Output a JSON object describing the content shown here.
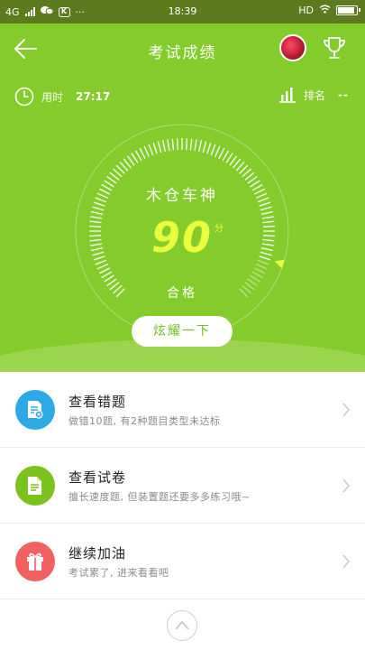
{
  "status_bar": {
    "network": "4G",
    "time": "18:39",
    "right_label": "HD",
    "app_icon_letter": "K",
    "more": "···"
  },
  "header": {
    "title": "考试成绩"
  },
  "stats": {
    "time_label": "用时",
    "time_value": "27:17",
    "rank_label": "排名",
    "rank_value": "--"
  },
  "gauge": {
    "name": "木仓车神",
    "score": "90",
    "unit": "分",
    "result": "合格",
    "score_fraction": 0.9
  },
  "share_button": {
    "label": "炫耀一下"
  },
  "items": [
    {
      "title": "查看错题",
      "subtitle": "做错10题, 有2种题目类型未达标",
      "color": "#2ea9e6",
      "icon": "document-x-icon"
    },
    {
      "title": "查看试卷",
      "subtitle": "擅长速度题, 但装置题还要多多练习哦~",
      "color": "#7cc21f",
      "icon": "document-icon"
    },
    {
      "title": "继续加油",
      "subtitle": "考试累了, 进来看看吧",
      "color": "#f0615f",
      "icon": "gift-icon"
    }
  ],
  "colors": {
    "accent": "#84cc2c",
    "score": "#e9ff3d",
    "status_bar": "#5b7b1c"
  }
}
